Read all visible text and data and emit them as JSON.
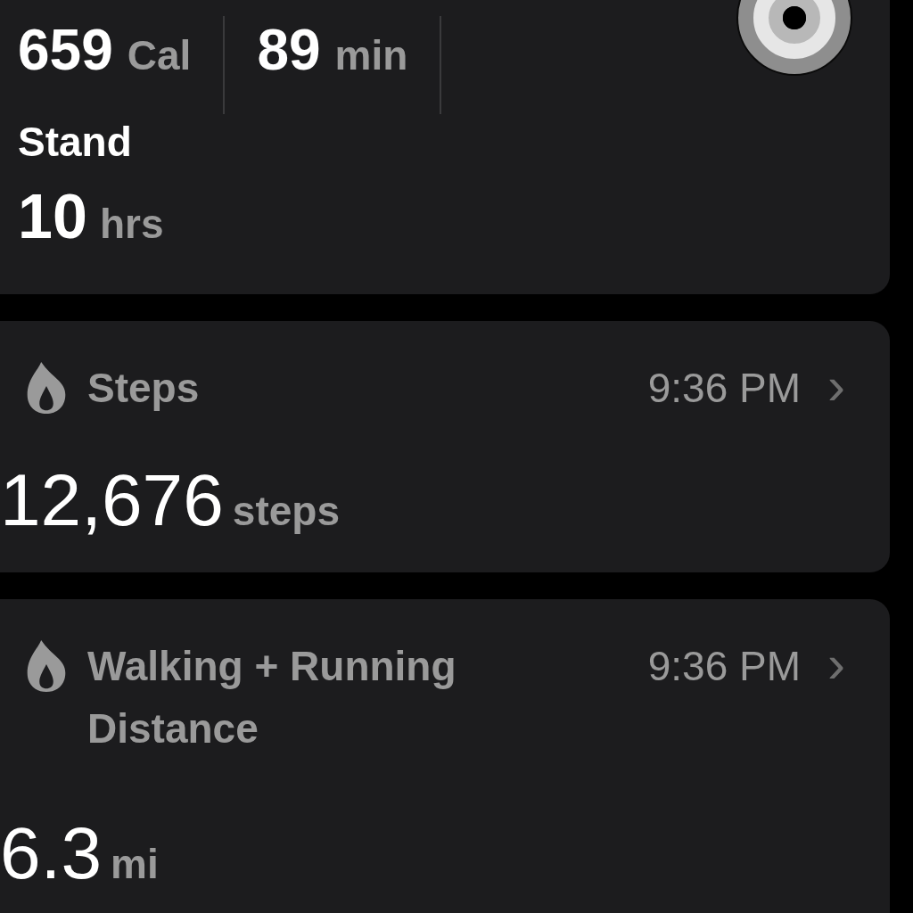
{
  "activity": {
    "metrics": [
      {
        "value": "659",
        "unit": "Cal"
      },
      {
        "value": "89",
        "unit": "min"
      }
    ],
    "stand": {
      "label": "Stand",
      "value": "10",
      "unit": "hrs"
    }
  },
  "cards": [
    {
      "title": "Steps",
      "time": "9:36 PM",
      "chevron": "›",
      "value": "12,676",
      "unit": "steps"
    },
    {
      "title": "Walking + Running Distance",
      "time": "9:36 PM",
      "chevron": "›",
      "value": "6.3",
      "unit": "mi"
    }
  ]
}
